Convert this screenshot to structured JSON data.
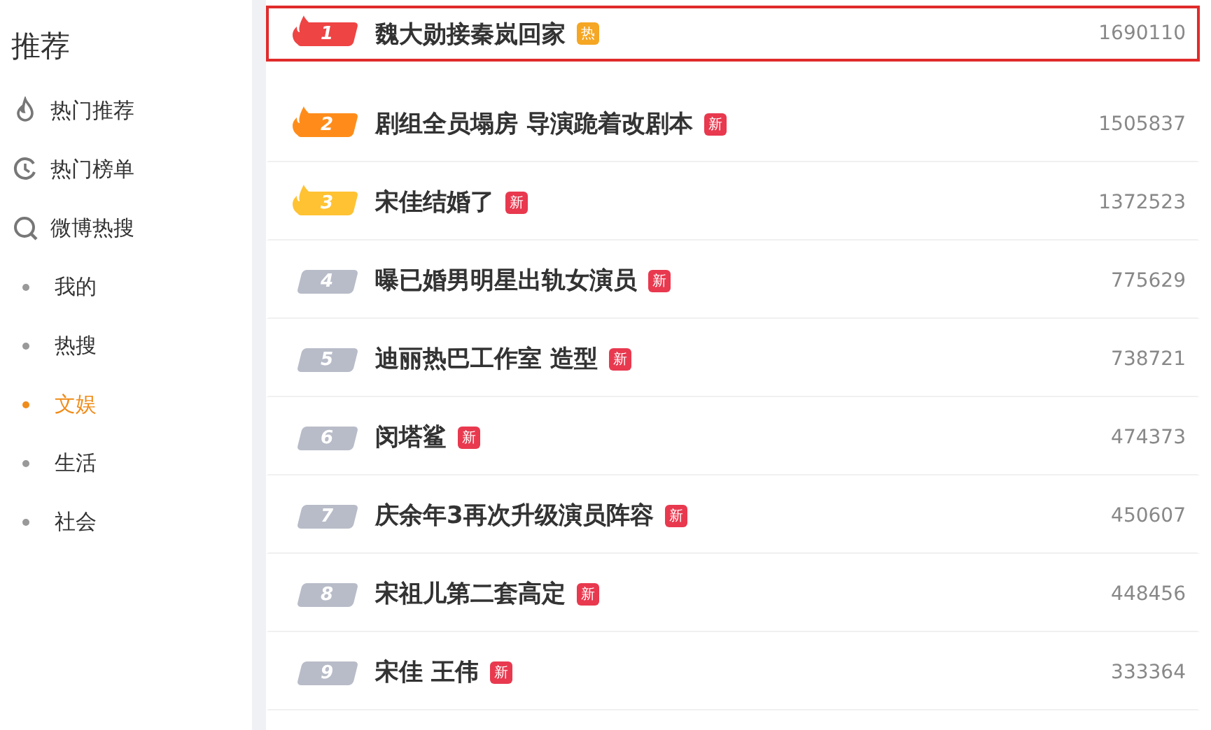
{
  "sidebar": {
    "title": "推荐",
    "items": [
      {
        "label": "热门推荐",
        "kind": "flame",
        "selected": false
      },
      {
        "label": "热门榜单",
        "kind": "clock",
        "selected": false
      },
      {
        "label": "微博热搜",
        "kind": "search",
        "selected": false
      },
      {
        "label": "我的",
        "kind": "bullet",
        "selected": false
      },
      {
        "label": "热搜",
        "kind": "bullet",
        "selected": false
      },
      {
        "label": "文娱",
        "kind": "bullet",
        "selected": true
      },
      {
        "label": "生活",
        "kind": "bullet",
        "selected": false
      },
      {
        "label": "社会",
        "kind": "bullet",
        "selected": false
      }
    ]
  },
  "list": [
    {
      "rank": "1",
      "flame": true,
      "color": "#ee4444",
      "title": "魏大勋接秦岚回家",
      "tag": {
        "text": "热",
        "color": "#f5a623"
      },
      "count": "1690110",
      "selected": true
    },
    {
      "rank": "2",
      "flame": true,
      "color": "#ff8c1a",
      "title": "剧组全员塌房 导演跪着改剧本",
      "tag": {
        "text": "新",
        "color": "#e8394f"
      },
      "count": "1505837",
      "selected": false
    },
    {
      "rank": "3",
      "flame": true,
      "color": "#ffc233",
      "title": "宋佳结婚了",
      "tag": {
        "text": "新",
        "color": "#e8394f"
      },
      "count": "1372523",
      "selected": false
    },
    {
      "rank": "4",
      "flame": false,
      "color": "#b8bcc8",
      "title": "曝已婚男明星出轨女演员",
      "tag": {
        "text": "新",
        "color": "#e8394f"
      },
      "count": "775629",
      "selected": false
    },
    {
      "rank": "5",
      "flame": false,
      "color": "#b8bcc8",
      "title": "迪丽热巴工作室 造型",
      "tag": {
        "text": "新",
        "color": "#e8394f"
      },
      "count": "738721",
      "selected": false
    },
    {
      "rank": "6",
      "flame": false,
      "color": "#b8bcc8",
      "title": "闵塔鲨",
      "tag": {
        "text": "新",
        "color": "#e8394f"
      },
      "count": "474373",
      "selected": false
    },
    {
      "rank": "7",
      "flame": false,
      "color": "#b8bcc8",
      "title": "庆余年3再次升级演员阵容",
      "tag": {
        "text": "新",
        "color": "#e8394f"
      },
      "count": "450607",
      "selected": false
    },
    {
      "rank": "8",
      "flame": false,
      "color": "#b8bcc8",
      "title": "宋祖儿第二套高定",
      "tag": {
        "text": "新",
        "color": "#e8394f"
      },
      "count": "448456",
      "selected": false
    },
    {
      "rank": "9",
      "flame": false,
      "color": "#b8bcc8",
      "title": "宋佳 王伟",
      "tag": {
        "text": "新",
        "color": "#e8394f"
      },
      "count": "333364",
      "selected": false
    }
  ]
}
